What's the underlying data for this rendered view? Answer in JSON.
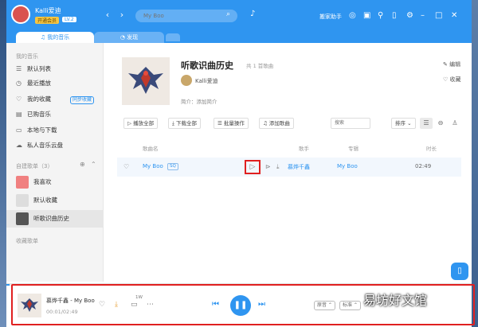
{
  "header": {
    "username": "Kalli爱迪",
    "vip_badge": "开通会员",
    "level_badge": "LV.2",
    "search_placeholder": "My Boo",
    "top_link": "搬家助手"
  },
  "tabs": [
    {
      "label": "♫ 我的音乐",
      "active": true
    },
    {
      "label": "◔ 发现",
      "active": false
    }
  ],
  "sidebar": {
    "section_my_music": "我的音乐",
    "items": [
      {
        "label": "默认列表",
        "icon": "list-icon"
      },
      {
        "label": "最近播放",
        "icon": "clock-icon"
      },
      {
        "label": "我的收藏",
        "icon": "heart-icon",
        "badge": "同步收藏"
      },
      {
        "label": "已购音乐",
        "icon": "receipt-icon"
      },
      {
        "label": "本地与下载",
        "icon": "computer-icon"
      },
      {
        "label": "私人音乐云盘",
        "icon": "cloud-icon"
      }
    ],
    "section_created": "自建歌单（3）",
    "playlists": [
      {
        "label": "我喜欢"
      },
      {
        "label": "默认收藏"
      },
      {
        "label": "听歌识曲历史",
        "selected": true
      }
    ],
    "section_collected": "收藏歌单"
  },
  "playlist": {
    "title": "听歌识曲历史",
    "count": "共 1 首歌曲",
    "owner": "Kalli爱迪",
    "intro": "简介：添加简介",
    "edit_label": "编辑",
    "fav_label": "收藏",
    "actions": {
      "play_all": "播放全部",
      "download_all": "下载全部",
      "batch": "批量操作",
      "add_song": "添加歌曲"
    },
    "filter_placeholder": "搜索",
    "sort_label": "排序",
    "columns": {
      "title": "歌曲名",
      "artist": "歌手",
      "album": "专辑",
      "duration": "时长"
    },
    "songs": [
      {
        "title": "My Boo",
        "tag": "SQ",
        "artist": "慕烨千鑫",
        "album": "My Boo",
        "duration": "02:49"
      }
    ]
  },
  "player": {
    "now_playing": "慕烨千鑫 - My Boo",
    "time": "00:01/02:49",
    "progress": 0.006,
    "comment_count": "1W",
    "pill_1": "原音",
    "pill_2": "标准"
  },
  "watermark": "易坊好文馆"
}
